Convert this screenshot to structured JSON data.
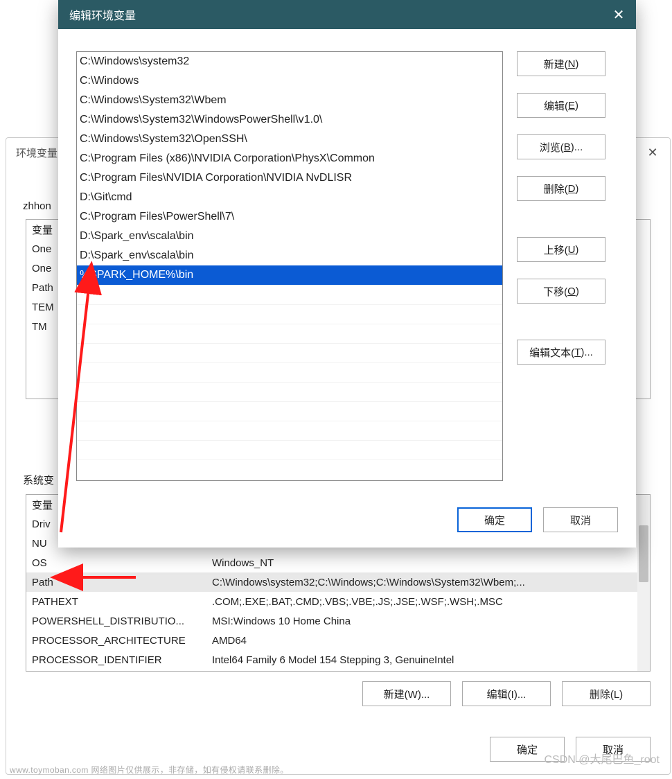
{
  "back_dialog": {
    "title": "环境变量",
    "close": "✕",
    "user_section_label": "zhhon",
    "user_table": {
      "header": "变量",
      "rows": [
        "One",
        "One",
        "Path",
        "TEM",
        "TM"
      ]
    },
    "system_section_label": "系统变",
    "system_table": {
      "header_var": "变量",
      "header_val": "",
      "rows": [
        {
          "k": "Driv",
          "v": ""
        },
        {
          "k": "NU",
          "v": ""
        },
        {
          "k": "OS",
          "v": "Windows_NT"
        },
        {
          "k": "Path",
          "v": "C:\\Windows\\system32;C:\\Windows;C:\\Windows\\System32\\Wbem;...",
          "sel": true
        },
        {
          "k": "PATHEXT",
          "v": ".COM;.EXE;.BAT;.CMD;.VBS;.VBE;.JS;.JSE;.WSF;.WSH;.MSC"
        },
        {
          "k": "POWERSHELL_DISTRIBUTIO...",
          "v": "MSI:Windows 10 Home China"
        },
        {
          "k": "PROCESSOR_ARCHITECTURE",
          "v": "AMD64"
        },
        {
          "k": "PROCESSOR_IDENTIFIER",
          "v": "Intel64 Family 6 Model 154 Stepping 3, GenuineIntel"
        }
      ]
    },
    "buttons": {
      "new": "新建(W)...",
      "edit": "编辑(I)...",
      "delete": "删除(L)",
      "ok": "确定",
      "cancel": "取消"
    }
  },
  "front_dialog": {
    "title": "编辑环境变量",
    "close": "✕",
    "paths": [
      "C:\\Windows\\system32",
      "C:\\Windows",
      "C:\\Windows\\System32\\Wbem",
      "C:\\Windows\\System32\\WindowsPowerShell\\v1.0\\",
      "C:\\Windows\\System32\\OpenSSH\\",
      "C:\\Program Files (x86)\\NVIDIA Corporation\\PhysX\\Common",
      "C:\\Program Files\\NVIDIA Corporation\\NVIDIA NvDLISR",
      "D:\\Git\\cmd",
      "C:\\Program Files\\PowerShell\\7\\",
      "D:\\Spark_env\\scala\\bin",
      "D:\\Spark_env\\scala\\bin",
      "%SPARK_HOME%\\bin"
    ],
    "selected_index": 11,
    "buttons": {
      "new": {
        "t": "新建(",
        "m": "N",
        "s": ")"
      },
      "edit": {
        "t": "编辑(",
        "m": "E",
        "s": ")"
      },
      "browse": {
        "t": "浏览(",
        "m": "B",
        "s": ")..."
      },
      "delete": {
        "t": "删除(",
        "m": "D",
        "s": ")"
      },
      "up": {
        "t": "上移(",
        "m": "U",
        "s": ")"
      },
      "down": {
        "t": "下移(",
        "m": "O",
        "s": ")"
      },
      "edit_text": {
        "t": "编辑文本(",
        "m": "T",
        "s": ")..."
      },
      "ok": "确定",
      "cancel": "取消"
    }
  },
  "watermark1": "www.toymoban.com 网络图片仅供展示，非存储，如有侵权请联系删除。",
  "watermark2": "CSDN @大尾巴鱼_root"
}
